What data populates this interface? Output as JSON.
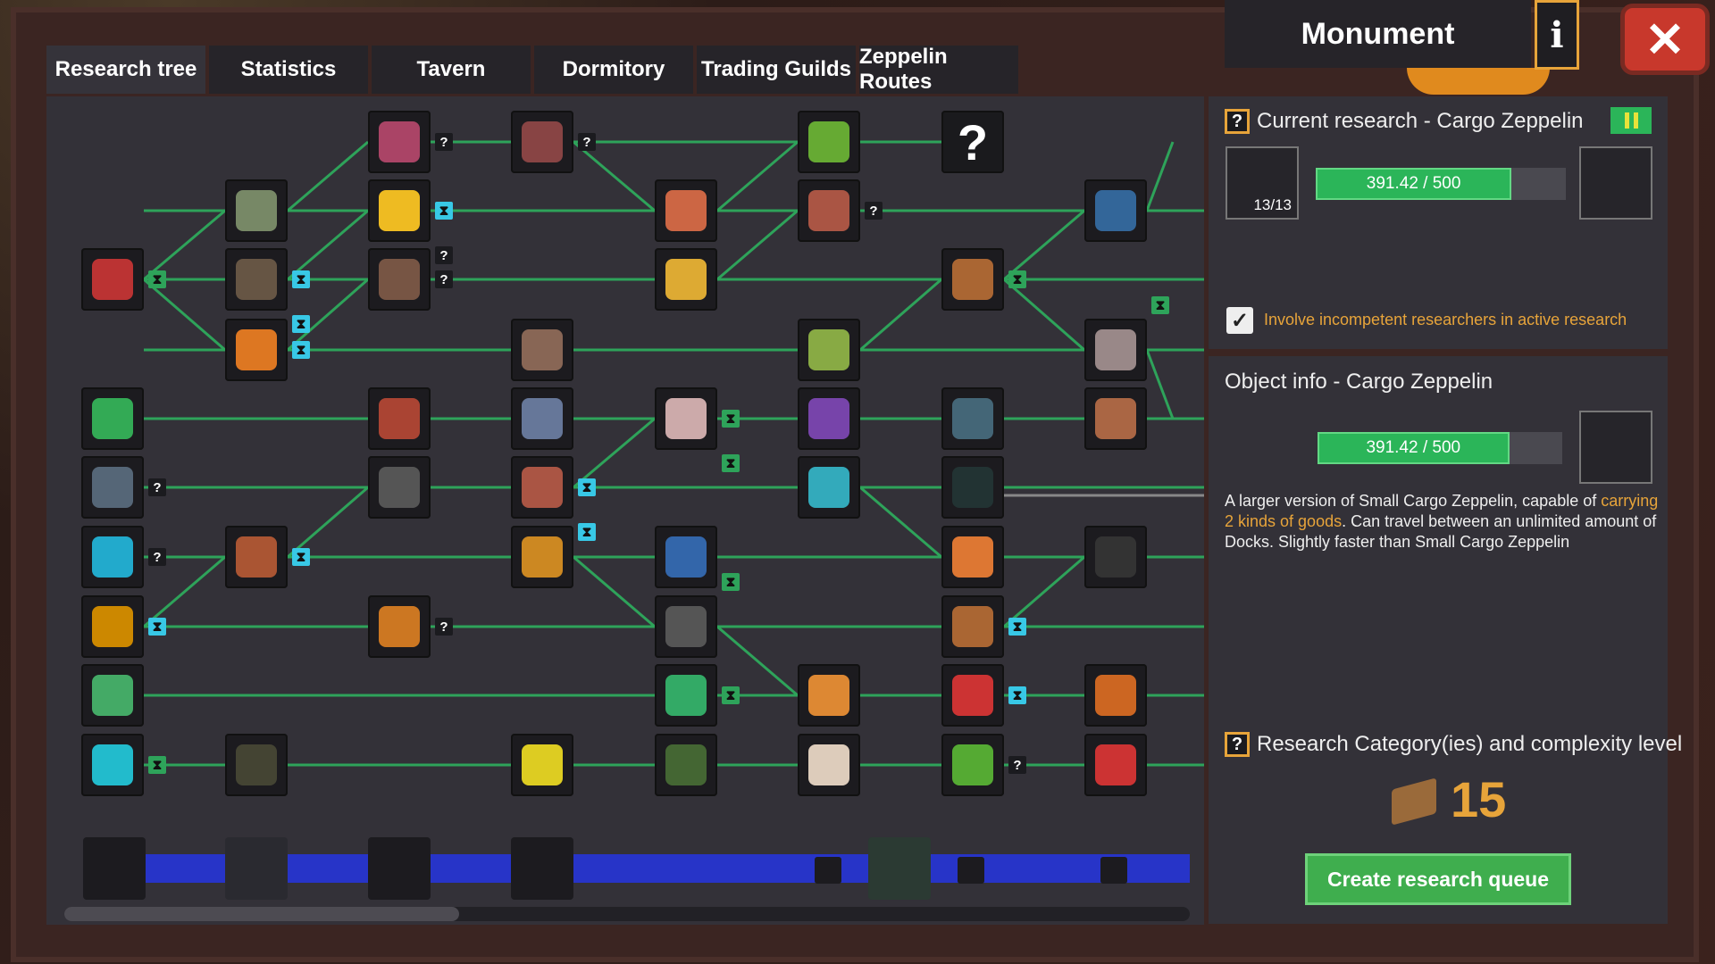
{
  "tabs": [
    {
      "label": "Research tree",
      "active": true
    },
    {
      "label": "Statistics"
    },
    {
      "label": "Tavern"
    },
    {
      "label": "Dormitory"
    },
    {
      "label": "Trading Guilds"
    },
    {
      "label": "Zeppelin Routes"
    }
  ],
  "window": {
    "title": "Monument",
    "info_icon": "info-icon",
    "close_icon": "close-icon"
  },
  "tree": {
    "unknown_node_label": "?",
    "badge_unknown": "?",
    "line_color": "#2ea35a"
  },
  "current_research": {
    "help": "?",
    "title": "Current research - Cargo Zeppelin",
    "researchers": "13/13",
    "progress_text": "391.42 / 500",
    "progress": 0.783,
    "paused_state_icon": "pause-icon",
    "checkbox_checked": true,
    "checkbox_label": "Involve incompetent researchers in active research"
  },
  "object_info": {
    "title": "Object info - Cargo Zeppelin",
    "progress_text": "391.42 / 500",
    "progress": 0.783,
    "desc_1": "A larger version of Small Cargo Zeppelin, capable of ",
    "desc_highlight": "carrying 2 kinds of goods",
    "desc_2": ". Can travel between an unlimited amount of Docks. Slightly faster than Small Cargo Zeppelin"
  },
  "category": {
    "help": "?",
    "title": "Research Category(ies) and complexity level",
    "level": "15"
  },
  "create_button": "Create research queue",
  "colors": {
    "accent": "#e7a43a",
    "progress": "#2bb559",
    "queue": "#2734c8",
    "close": "#c8382c"
  }
}
